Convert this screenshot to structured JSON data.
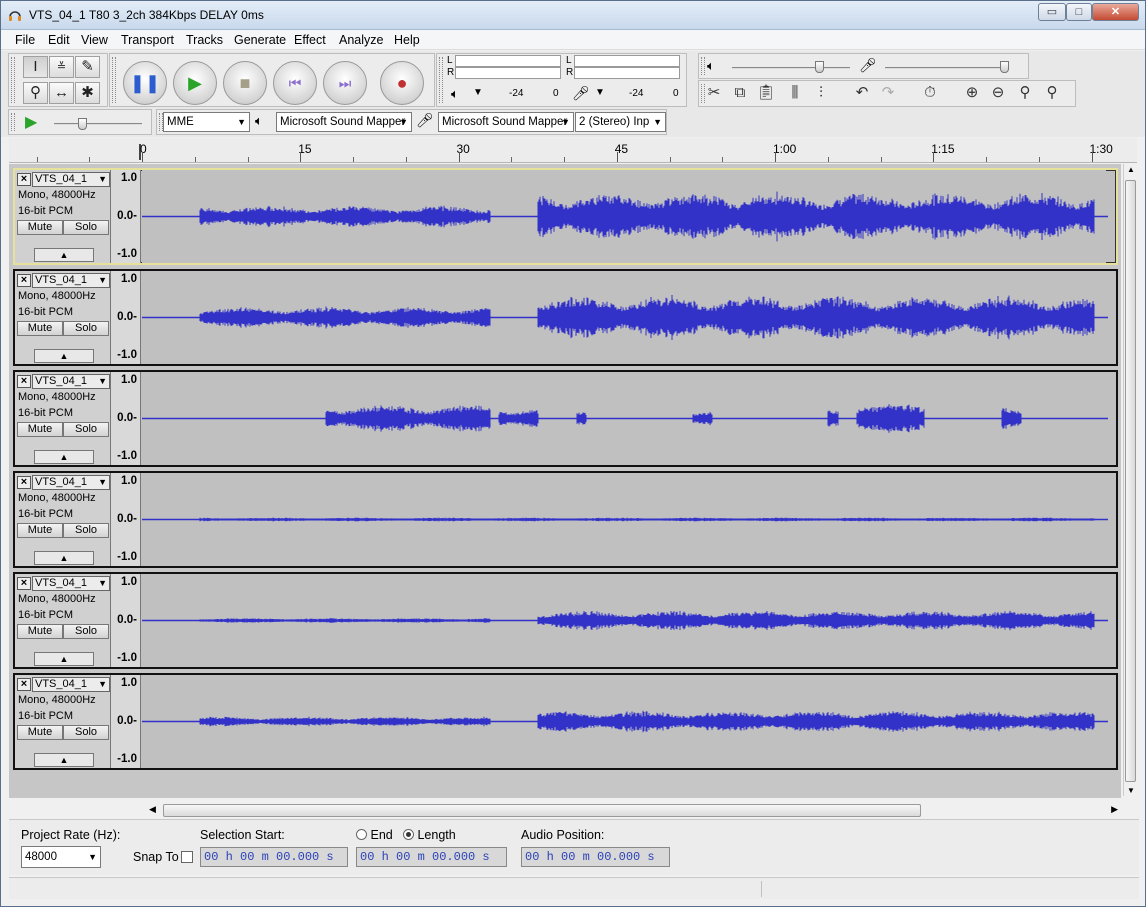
{
  "window": {
    "title": "VTS_04_1 T80 3_2ch 384Kbps DELAY 0ms",
    "minimize": "▭",
    "maximize": "□",
    "close": "✕"
  },
  "menu": [
    "File",
    "Edit",
    "View",
    "Transport",
    "Tracks",
    "Generate",
    "Effect",
    "Analyze",
    "Help"
  ],
  "meter": {
    "l": "L",
    "r": "R",
    "scale_play": [
      "-24",
      "0"
    ],
    "scale_rec": [
      "-24",
      "0"
    ]
  },
  "device": {
    "host": "MME",
    "output": "Microsoft Sound Mapper",
    "input": "Microsoft Sound Mapper",
    "channels": "2 (Stereo) Inp"
  },
  "timeline": {
    "labels": [
      "0",
      "15",
      "30",
      "45",
      "1:00",
      "1:15",
      "1:30"
    ]
  },
  "track_common": {
    "name": "VTS_04_1",
    "format": "Mono, 48000Hz",
    "bits": "16-bit PCM",
    "mute": "Mute",
    "solo": "Solo",
    "scale_top": "1.0",
    "scale_mid": "0.0-",
    "scale_bot": "-1.0"
  },
  "tracks": [
    {
      "selected": true,
      "color": "#3232c8",
      "segments": [
        [
          0.06,
          0.36,
          0.22
        ],
        [
          0.41,
          0.985,
          0.5
        ]
      ]
    },
    {
      "selected": false,
      "color": "#3232c8",
      "segments": [
        [
          0.06,
          0.36,
          0.22
        ],
        [
          0.41,
          0.985,
          0.45
        ]
      ]
    },
    {
      "selected": false,
      "color": "#3232c8",
      "segments": [
        [
          0.19,
          0.36,
          0.28
        ],
        [
          0.37,
          0.41,
          0.22
        ],
        [
          0.45,
          0.46,
          0.18
        ],
        [
          0.57,
          0.59,
          0.15
        ],
        [
          0.71,
          0.72,
          0.22
        ],
        [
          0.74,
          0.81,
          0.32
        ],
        [
          0.89,
          0.91,
          0.28
        ]
      ]
    },
    {
      "selected": false,
      "color": "#3232c8",
      "segments": [
        [
          0.06,
          0.985,
          0.04
        ]
      ]
    },
    {
      "selected": false,
      "color": "#3232c8",
      "segments": [
        [
          0.06,
          0.36,
          0.05
        ],
        [
          0.41,
          0.985,
          0.2
        ]
      ]
    },
    {
      "selected": false,
      "color": "#3232c8",
      "segments": [
        [
          0.06,
          0.36,
          0.1
        ],
        [
          0.41,
          0.985,
          0.22
        ]
      ]
    }
  ],
  "bottom": {
    "project_rate_label": "Project Rate (Hz):",
    "project_rate": "48000",
    "snap_label": "Snap To",
    "selection_start_label": "Selection Start:",
    "end_label": "End",
    "length_label": "Length",
    "audio_position_label": "Audio Position:",
    "time_value": "00 h 00 m 00.000 s"
  }
}
